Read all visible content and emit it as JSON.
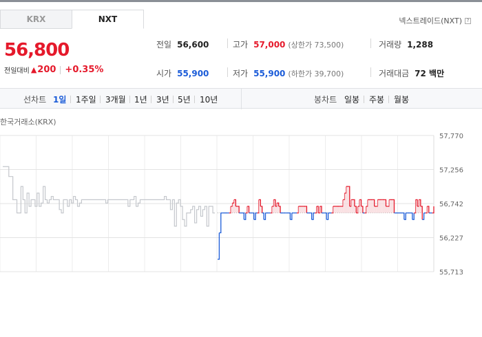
{
  "tabs": [
    {
      "label": "KRX"
    },
    {
      "label": "NXT"
    }
  ],
  "nxt_link": "넥스트레이드(NXT)",
  "price": "56,800",
  "change": {
    "label": "전일대비",
    "value": "200",
    "percent": "+0.35%"
  },
  "stats": {
    "prev_close": {
      "label": "전일",
      "value": "56,600"
    },
    "high": {
      "label": "고가",
      "value": "57,000",
      "sub": "(상한가 73,500)"
    },
    "volume": {
      "label": "거래량",
      "value": "1,288"
    },
    "open": {
      "label": "시가",
      "value": "55,900"
    },
    "low": {
      "label": "저가",
      "value": "55,900",
      "sub": "(하한가 39,700)"
    },
    "turnover": {
      "label": "거래대금",
      "value": "72 백만"
    }
  },
  "toolbar": {
    "line_label": "선차트",
    "periods": [
      "1일",
      "1주일",
      "3개월",
      "1년",
      "3년",
      "5년",
      "10년"
    ],
    "candle_label": "봉차트",
    "candle_periods": [
      "일봉",
      "주봉",
      "월봉"
    ]
  },
  "chart_title": "한국거래소(KRX)",
  "colors": {
    "up": "#e5192b",
    "down": "#1a5bd8",
    "inactive": "#c4c7cc",
    "fill_up": "#f8d9dc"
  },
  "chart_data": {
    "type": "line",
    "baseline": 56600,
    "ylim": [
      55713,
      57770
    ],
    "y_ticks": [
      "57,770",
      "57,256",
      "56,742",
      "56,227",
      "55,713"
    ],
    "y_tick_values": [
      57770,
      57256,
      56742,
      56227,
      55713
    ],
    "grid": true,
    "series": [
      {
        "values": [
          57300,
          57300,
          57300,
          57150,
          57150,
          56800,
          56800,
          56600,
          56600,
          57000,
          56800,
          56600,
          56900,
          56700,
          56800,
          56800,
          56700,
          56900,
          56700,
          56750,
          57000,
          56800,
          56750,
          56800,
          56850,
          56800,
          56800,
          56800,
          56650,
          56600,
          56800,
          56800,
          56700,
          56800,
          56750,
          56850,
          56800,
          56700,
          56750,
          56800,
          56800,
          56800,
          56800,
          56800,
          56800,
          56800,
          56800,
          56800,
          56800,
          56800,
          56800,
          56750,
          56800,
          56800,
          56800,
          56800,
          56800,
          56800,
          56800,
          56800,
          56800,
          56800,
          56700,
          56800,
          56800,
          56850,
          56700,
          56750,
          56800,
          56800,
          56800,
          56800,
          56800,
          56800,
          56800,
          56800,
          56800,
          56800,
          56800,
          56800,
          56850,
          56800,
          56800,
          56650,
          56800,
          56400,
          56750,
          56800,
          56700,
          56500,
          56400,
          56600,
          56600,
          56650,
          56700,
          56450,
          56650,
          56700,
          56550,
          56650,
          56700,
          56400,
          56700,
          56700,
          56600,
          56600
        ]
      },
      {
        "values": [
          55900,
          56300,
          56600,
          56600,
          56600,
          56600,
          56600,
          56600,
          56700,
          56750,
          56800,
          56700,
          56700,
          56600,
          56600,
          56600,
          56500,
          56600,
          56700,
          56600,
          56600,
          56600,
          56500,
          56600,
          56600,
          56800,
          56700,
          56600,
          56500,
          56600,
          56600,
          56600,
          56600,
          56700,
          56800,
          56700,
          56750,
          56700,
          56600,
          56600,
          56600,
          56600,
          56600,
          56600,
          56500,
          56600,
          56600,
          56600,
          56600,
          56700,
          56700,
          56700,
          56700,
          56700,
          56600,
          56600,
          56600,
          56500,
          56600,
          56600,
          56700,
          56600,
          56700,
          56600,
          56600,
          56600,
          56500,
          56600,
          56600,
          56600,
          56700,
          56700,
          56700,
          56700,
          56700,
          56700,
          56800,
          56900,
          57000,
          57000,
          56700,
          56800,
          56800,
          56700,
          56600,
          56700,
          56800,
          56700,
          56600,
          56600,
          56700,
          56800,
          56800,
          56800,
          56800,
          56700,
          56700,
          56800,
          56800,
          56800,
          56800,
          56800,
          56700,
          56700,
          56800,
          56800,
          56800,
          56600,
          56600,
          56600,
          56600,
          56600,
          56600,
          56500,
          56600,
          56600,
          56600,
          56600,
          56500,
          56600,
          56800,
          56700,
          56800,
          56700,
          56500,
          56600,
          56600,
          56700,
          56600,
          56600,
          56600,
          56700
        ]
      }
    ]
  }
}
